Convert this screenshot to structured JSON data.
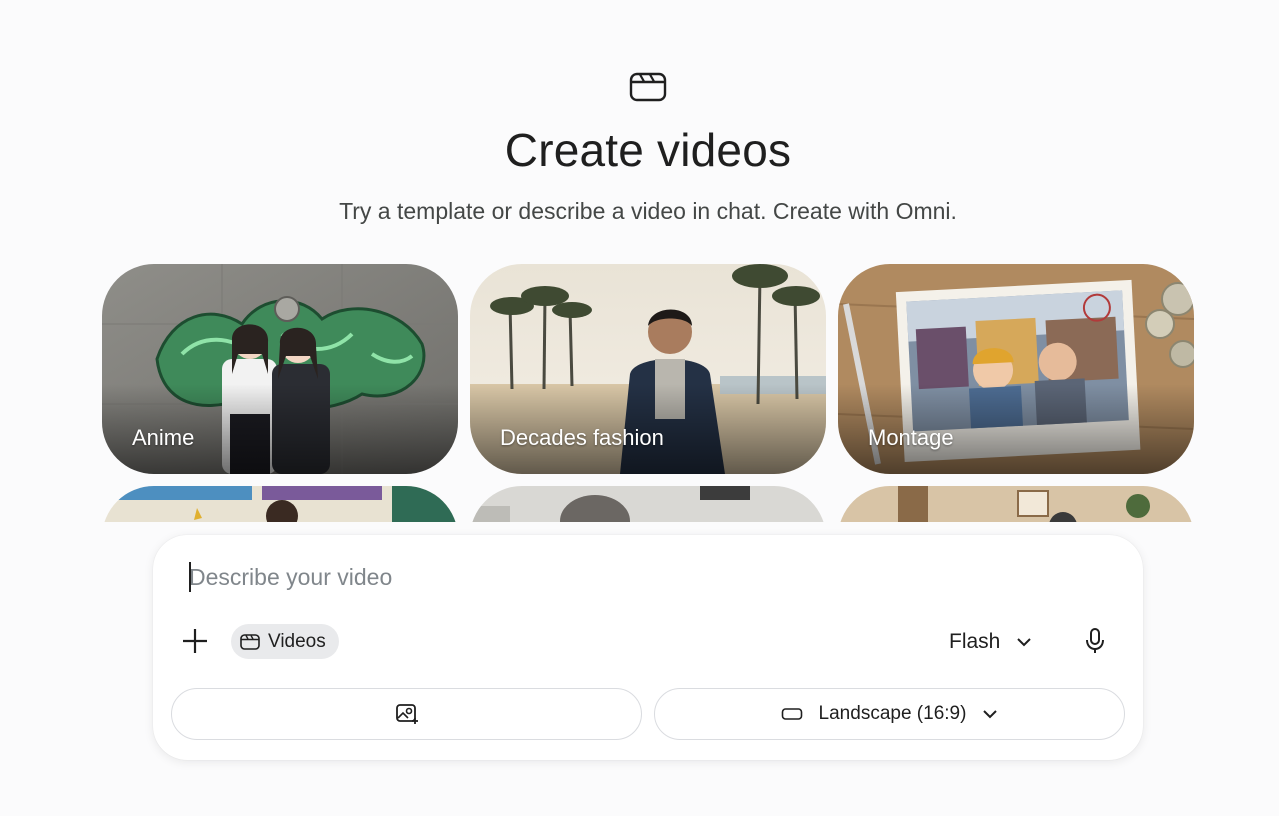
{
  "header": {
    "icon": "video-clapper-icon",
    "title": "Create videos",
    "subtitle": "Try a template or describe a video in chat. Create with Omni."
  },
  "templates": [
    {
      "label": "Anime"
    },
    {
      "label": "Decades fashion"
    },
    {
      "label": "Montage"
    },
    {
      "label": ""
    },
    {
      "label": ""
    },
    {
      "label": ""
    }
  ],
  "composer": {
    "placeholder": "Describe your video",
    "add_icon": "plus-icon",
    "tool_chip": {
      "icon": "video-clapper-icon",
      "label": "Videos"
    },
    "model": {
      "label": "Flash",
      "icon": "chevron-down-icon"
    },
    "mic_icon": "microphone-icon",
    "image_button": {
      "icon": "add-image-icon"
    },
    "aspect_button": {
      "icon": "landscape-rect-icon",
      "label": "Landscape (16:9)",
      "dropdown_icon": "chevron-down-icon"
    }
  }
}
